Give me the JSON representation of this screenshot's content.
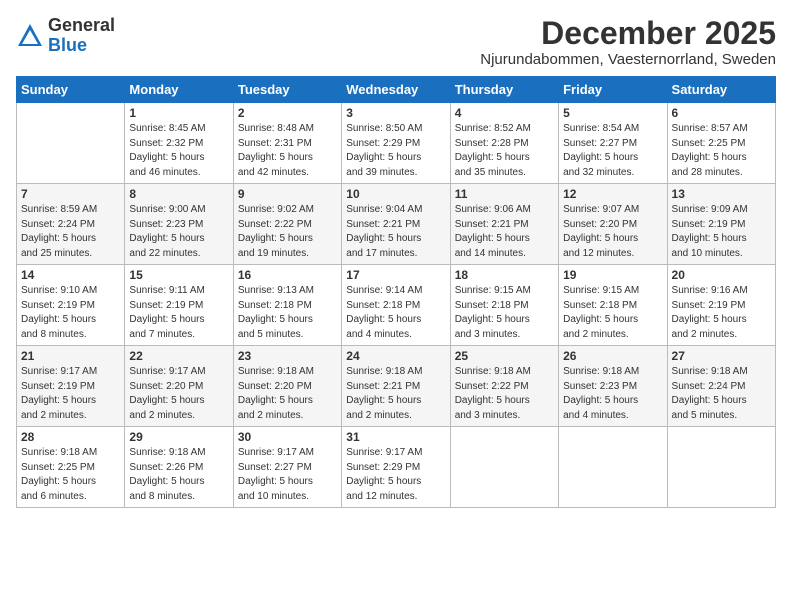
{
  "header": {
    "logo": {
      "general": "General",
      "blue": "Blue"
    },
    "title": "December 2025",
    "location": "Njurundabommen, Vaesternorrland, Sweden"
  },
  "weekdays": [
    "Sunday",
    "Monday",
    "Tuesday",
    "Wednesday",
    "Thursday",
    "Friday",
    "Saturday"
  ],
  "weeks": [
    [
      {
        "day": "",
        "info": ""
      },
      {
        "day": "1",
        "info": "Sunrise: 8:45 AM\nSunset: 2:32 PM\nDaylight: 5 hours\nand 46 minutes."
      },
      {
        "day": "2",
        "info": "Sunrise: 8:48 AM\nSunset: 2:31 PM\nDaylight: 5 hours\nand 42 minutes."
      },
      {
        "day": "3",
        "info": "Sunrise: 8:50 AM\nSunset: 2:29 PM\nDaylight: 5 hours\nand 39 minutes."
      },
      {
        "day": "4",
        "info": "Sunrise: 8:52 AM\nSunset: 2:28 PM\nDaylight: 5 hours\nand 35 minutes."
      },
      {
        "day": "5",
        "info": "Sunrise: 8:54 AM\nSunset: 2:27 PM\nDaylight: 5 hours\nand 32 minutes."
      },
      {
        "day": "6",
        "info": "Sunrise: 8:57 AM\nSunset: 2:25 PM\nDaylight: 5 hours\nand 28 minutes."
      }
    ],
    [
      {
        "day": "7",
        "info": "Sunrise: 8:59 AM\nSunset: 2:24 PM\nDaylight: 5 hours\nand 25 minutes."
      },
      {
        "day": "8",
        "info": "Sunrise: 9:00 AM\nSunset: 2:23 PM\nDaylight: 5 hours\nand 22 minutes."
      },
      {
        "day": "9",
        "info": "Sunrise: 9:02 AM\nSunset: 2:22 PM\nDaylight: 5 hours\nand 19 minutes."
      },
      {
        "day": "10",
        "info": "Sunrise: 9:04 AM\nSunset: 2:21 PM\nDaylight: 5 hours\nand 17 minutes."
      },
      {
        "day": "11",
        "info": "Sunrise: 9:06 AM\nSunset: 2:21 PM\nDaylight: 5 hours\nand 14 minutes."
      },
      {
        "day": "12",
        "info": "Sunrise: 9:07 AM\nSunset: 2:20 PM\nDaylight: 5 hours\nand 12 minutes."
      },
      {
        "day": "13",
        "info": "Sunrise: 9:09 AM\nSunset: 2:19 PM\nDaylight: 5 hours\nand 10 minutes."
      }
    ],
    [
      {
        "day": "14",
        "info": "Sunrise: 9:10 AM\nSunset: 2:19 PM\nDaylight: 5 hours\nand 8 minutes."
      },
      {
        "day": "15",
        "info": "Sunrise: 9:11 AM\nSunset: 2:19 PM\nDaylight: 5 hours\nand 7 minutes."
      },
      {
        "day": "16",
        "info": "Sunrise: 9:13 AM\nSunset: 2:18 PM\nDaylight: 5 hours\nand 5 minutes."
      },
      {
        "day": "17",
        "info": "Sunrise: 9:14 AM\nSunset: 2:18 PM\nDaylight: 5 hours\nand 4 minutes."
      },
      {
        "day": "18",
        "info": "Sunrise: 9:15 AM\nSunset: 2:18 PM\nDaylight: 5 hours\nand 3 minutes."
      },
      {
        "day": "19",
        "info": "Sunrise: 9:15 AM\nSunset: 2:18 PM\nDaylight: 5 hours\nand 2 minutes."
      },
      {
        "day": "20",
        "info": "Sunrise: 9:16 AM\nSunset: 2:19 PM\nDaylight: 5 hours\nand 2 minutes."
      }
    ],
    [
      {
        "day": "21",
        "info": "Sunrise: 9:17 AM\nSunset: 2:19 PM\nDaylight: 5 hours\nand 2 minutes."
      },
      {
        "day": "22",
        "info": "Sunrise: 9:17 AM\nSunset: 2:20 PM\nDaylight: 5 hours\nand 2 minutes."
      },
      {
        "day": "23",
        "info": "Sunrise: 9:18 AM\nSunset: 2:20 PM\nDaylight: 5 hours\nand 2 minutes."
      },
      {
        "day": "24",
        "info": "Sunrise: 9:18 AM\nSunset: 2:21 PM\nDaylight: 5 hours\nand 2 minutes."
      },
      {
        "day": "25",
        "info": "Sunrise: 9:18 AM\nSunset: 2:22 PM\nDaylight: 5 hours\nand 3 minutes."
      },
      {
        "day": "26",
        "info": "Sunrise: 9:18 AM\nSunset: 2:23 PM\nDaylight: 5 hours\nand 4 minutes."
      },
      {
        "day": "27",
        "info": "Sunrise: 9:18 AM\nSunset: 2:24 PM\nDaylight: 5 hours\nand 5 minutes."
      }
    ],
    [
      {
        "day": "28",
        "info": "Sunrise: 9:18 AM\nSunset: 2:25 PM\nDaylight: 5 hours\nand 6 minutes."
      },
      {
        "day": "29",
        "info": "Sunrise: 9:18 AM\nSunset: 2:26 PM\nDaylight: 5 hours\nand 8 minutes."
      },
      {
        "day": "30",
        "info": "Sunrise: 9:17 AM\nSunset: 2:27 PM\nDaylight: 5 hours\nand 10 minutes."
      },
      {
        "day": "31",
        "info": "Sunrise: 9:17 AM\nSunset: 2:29 PM\nDaylight: 5 hours\nand 12 minutes."
      },
      {
        "day": "",
        "info": ""
      },
      {
        "day": "",
        "info": ""
      },
      {
        "day": "",
        "info": ""
      }
    ]
  ]
}
